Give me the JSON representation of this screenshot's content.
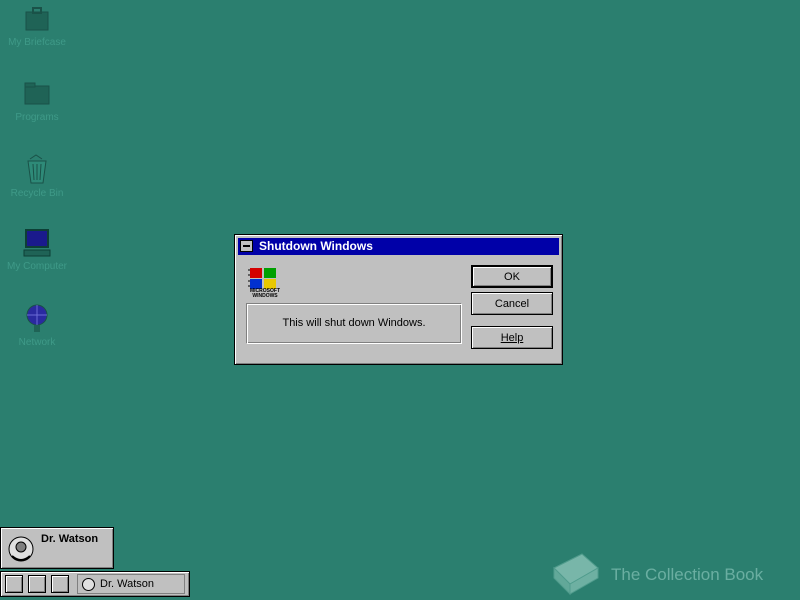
{
  "desktop": {
    "icons": [
      {
        "label": "My Briefcase",
        "icon": "briefcase-icon"
      },
      {
        "label": "Programs",
        "icon": "folder-icon"
      },
      {
        "label": "Recycle Bin",
        "icon": "recycle-bin-icon"
      },
      {
        "label": "My Computer",
        "icon": "computer-icon"
      },
      {
        "label": "Network",
        "icon": "network-icon"
      }
    ]
  },
  "dialog": {
    "title": "Shutdown Windows",
    "logo_text": "MICROSOFT WINDOWS",
    "message": "This will shut down Windows.",
    "buttons": {
      "ok": "OK",
      "cancel": "Cancel",
      "help": "Help"
    }
  },
  "minimized_window": {
    "label": "Dr. Watson",
    "icon": "dr-watson-icon"
  },
  "taskbar": {
    "task_label": "Dr. Watson"
  },
  "watermark": {
    "text": "The Collection Book"
  },
  "colors": {
    "desktop": "#2b7f6f",
    "titlebar": "#0000a8",
    "face": "#c0c0c0"
  }
}
